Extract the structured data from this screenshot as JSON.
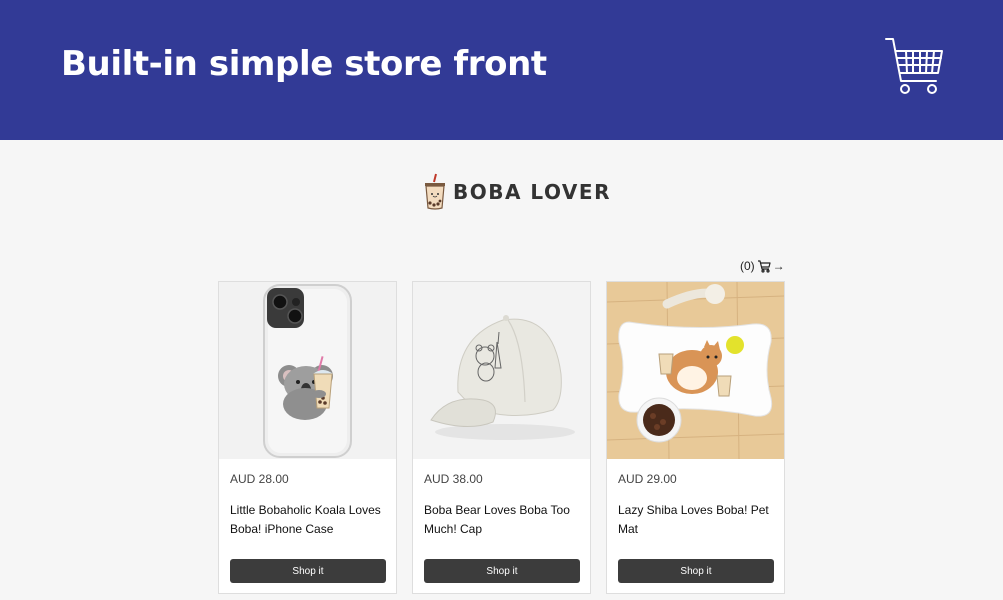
{
  "header": {
    "title": "Built-in simple store front",
    "cart_icon": "shopping-cart-icon"
  },
  "brand": {
    "name": "BOBA LOVER",
    "logo_icon": "boba-cup-icon"
  },
  "cart": {
    "count_label": "(0)",
    "cart_icon": "cart-icon",
    "arrow": "→"
  },
  "products": [
    {
      "price": "AUD 28.00",
      "title": "Little Bobaholic Koala Loves Boba! iPhone Case",
      "button": "Shop it",
      "image": "koala-phone-case"
    },
    {
      "price": "AUD 38.00",
      "title": "Boba Bear Loves Boba Too Much! Cap",
      "button": "Shop it",
      "image": "boba-bear-cap"
    },
    {
      "price": "AUD 29.00",
      "title": "Lazy Shiba Loves Boba! Pet Mat",
      "button": "Shop it",
      "image": "shiba-pet-mat"
    }
  ],
  "colors": {
    "header_bg": "#323a96",
    "page_bg": "#f6f6f6",
    "button_bg": "#3c3c3c"
  }
}
